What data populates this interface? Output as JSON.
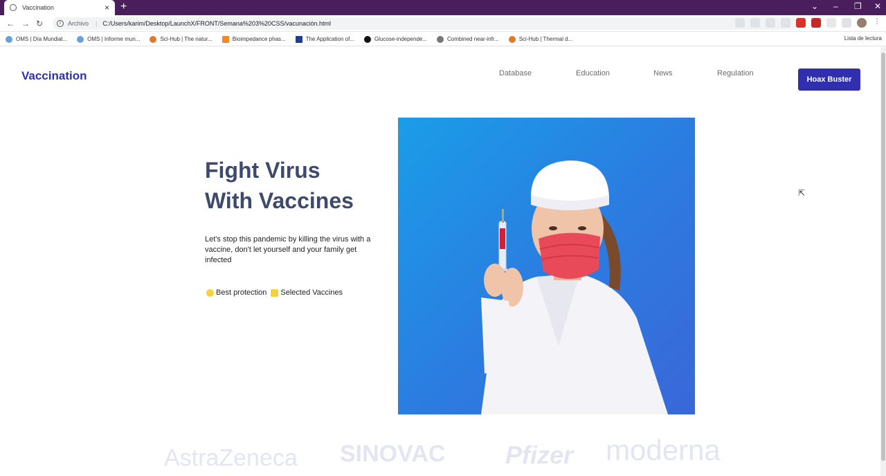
{
  "browser": {
    "tab_title": "Vaccination",
    "address_prefix": "Archivo",
    "url": "C:/Users/karim/Desktop/LaunchX/FRONT/Semana%203%20CSS/vacunación.html",
    "bookmarks": [
      "OMS | Día Mundial...",
      "OMS | Informe mun...",
      "Sci-Hub | The natur...",
      "Bioimpedance phas...",
      "The Application of...",
      "Glucose-independe...",
      "Combined near-infr...",
      "Sci-Hub | Thermal d..."
    ],
    "reading_list": "Lista de lectura"
  },
  "site": {
    "logo": "Vaccination",
    "nav": [
      "Database",
      "Education",
      "News",
      "Regulation"
    ],
    "cta": "Hoax Buster",
    "hero_title_line1": "Fight Virus",
    "hero_title_line2": "With Vaccines",
    "hero_description": "Let's stop this pandemic by killing the virus with a vaccine, don't let yourself and your family get infected",
    "badge_1": "Best protection",
    "badge_2": "Selected Vaccines",
    "brands": [
      "AstraZeneca",
      "SINOVAC",
      "Pfizer",
      "moderna"
    ],
    "colors": {
      "brand": "#2f31a8",
      "cta_bg": "#2f2fb0",
      "title": "#3d4a6b",
      "badge": "#f7d23b",
      "hero_bg": "#2c7be0"
    }
  }
}
